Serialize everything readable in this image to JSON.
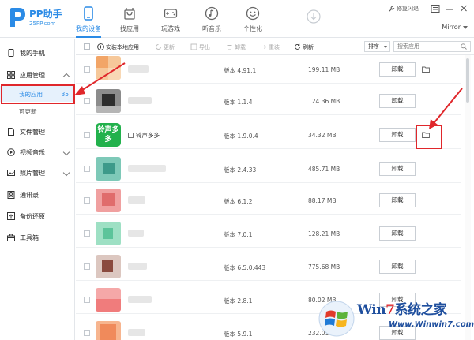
{
  "app": {
    "title": "PP助手",
    "subtitle": "25PP.com",
    "repair_label": "修复闪退",
    "mirror_label": "Mirror"
  },
  "nav": [
    {
      "label": "我的设备",
      "icon": "phone-icon",
      "active": true
    },
    {
      "label": "找应用",
      "icon": "shopping-bag-icon",
      "active": false
    },
    {
      "label": "玩游戏",
      "icon": "gamepad-icon",
      "active": false
    },
    {
      "label": "听音乐",
      "icon": "music-disc-icon",
      "active": false
    },
    {
      "label": "个性化",
      "icon": "smiley-icon",
      "active": false
    }
  ],
  "sidebar": {
    "my_phone": "我的手机",
    "app_manage": "应用管理",
    "my_apps": "我的应用",
    "my_apps_count": "35",
    "updatable": "可更新",
    "file_manage": "文件管理",
    "video_music": "视频音乐",
    "photo_manage": "照片管理",
    "contacts": "通讯录",
    "backup": "备份还原",
    "toolbox": "工具箱"
  },
  "toolbar": {
    "install_local": "安装本地应用",
    "update": "更新",
    "export": "导出",
    "uninstall": "卸载",
    "reinstall": "重装",
    "refresh": "刷新",
    "sort": "排序",
    "search_placeholder": "搜索应用"
  },
  "rows": [
    {
      "version": "版本 4.91.1",
      "size": "199.11 MB",
      "button": "卸载",
      "name": ""
    },
    {
      "version": "版本 1.1.4",
      "size": "124.36 MB",
      "button": "卸载",
      "name": ""
    },
    {
      "version": "版本 1.9.0.4",
      "size": "34.32 MB",
      "button": "卸载",
      "name": "铃声多多",
      "icon_text": "铃声多多"
    },
    {
      "version": "版本 2.4.33",
      "size": "485.71 MB",
      "button": "卸载",
      "name": ""
    },
    {
      "version": "版本 6.1.2",
      "size": "88.17 MB",
      "button": "卸载",
      "name": ""
    },
    {
      "version": "版本 7.0.1",
      "size": "128.21 MB",
      "button": "卸载",
      "name": ""
    },
    {
      "version": "版本 6.5.0.443",
      "size": "775.68 MB",
      "button": "卸载",
      "name": ""
    },
    {
      "version": "版本 2.8.1",
      "size": "80.02 MB",
      "button": "卸载",
      "name": ""
    },
    {
      "version": "版本 5.9.1",
      "size": "232.01 MB",
      "button": "卸载",
      "name": ""
    }
  ],
  "watermark": {
    "title_a": "Win",
    "title_7": "7",
    "title_b": "系统之家",
    "url": "Www.Winwin7.com"
  },
  "colors": {
    "accent": "#2b8be6",
    "highlight": "#e0272b"
  }
}
